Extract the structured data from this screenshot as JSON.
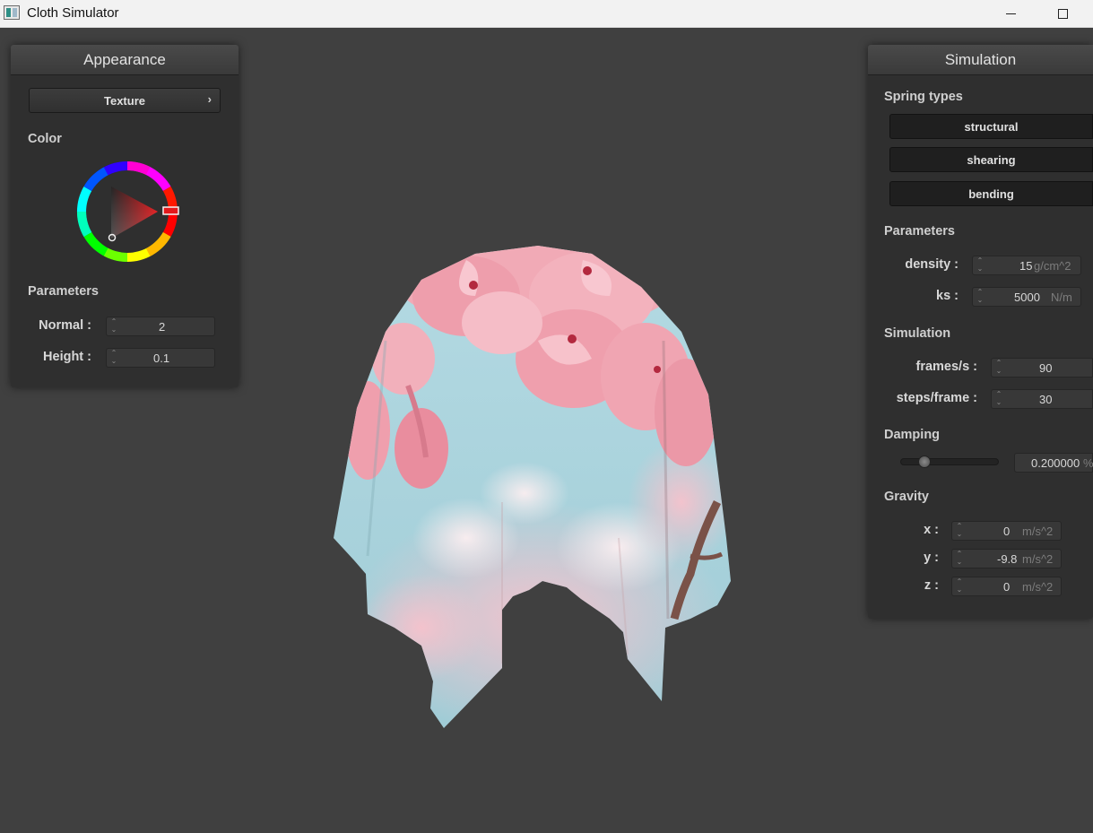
{
  "window": {
    "title": "Cloth Simulator"
  },
  "appearance": {
    "header": "Appearance",
    "texture_button": "Texture",
    "color_label": "Color",
    "parameters_label": "Parameters",
    "normal_label": "Normal :",
    "normal_value": "2",
    "height_label": "Height :",
    "height_value": "0.1",
    "selected_color": "#e3191c"
  },
  "simulation": {
    "header": "Simulation",
    "spring_types_label": "Spring types",
    "spring_buttons": [
      "structural",
      "shearing",
      "bending"
    ],
    "parameters_label": "Parameters",
    "density_label": "density :",
    "density_value": "15",
    "density_unit": "g/cm^2",
    "ks_label": "ks :",
    "ks_value": "5000",
    "ks_unit": "N/m",
    "simulation_label": "Simulation",
    "fps_label": "frames/s :",
    "fps_value": "90",
    "steps_label": "steps/frame :",
    "steps_value": "30",
    "damping_label": "Damping",
    "damping_value": "0.200000",
    "damping_unit": "%",
    "damping_slider_fraction": 0.2,
    "gravity_label": "Gravity",
    "gx_label": "x :",
    "gx_value": "0",
    "gy_label": "y :",
    "gy_value": "-9.8",
    "gz_label": "z :",
    "gz_value": "0",
    "gravity_unit": "m/s^2"
  },
  "icons": {
    "app": "app-window-icon",
    "minimize": "minimize-icon",
    "maximize": "maximize-icon",
    "spin": "spin-arrows-icon",
    "chevron": "chevron-right-icon"
  },
  "colors": {
    "background": "#404040",
    "panel": "#2f2f2f",
    "cloth_sky": "#a6d2dc",
    "cloth_blossom": "#ef9fae"
  }
}
